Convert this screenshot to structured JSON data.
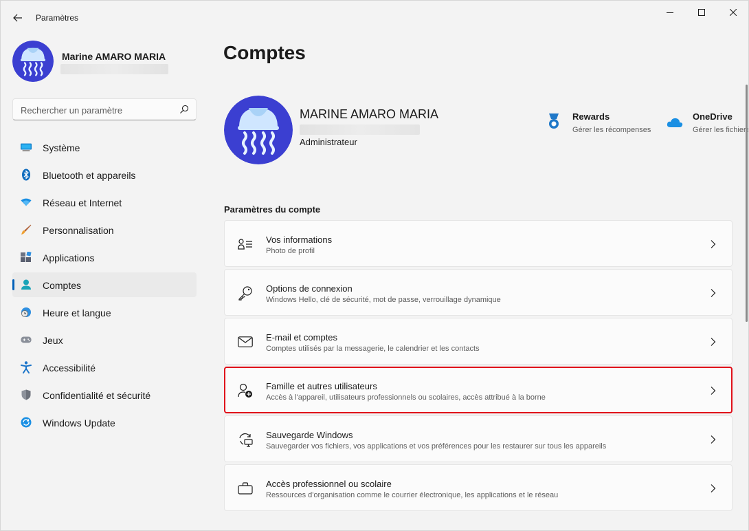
{
  "window": {
    "title": "Paramètres"
  },
  "sidebar": {
    "profile_name": "Marine AMARO MARIA",
    "search_placeholder": "Rechercher un paramètre",
    "items": [
      {
        "label": "Système",
        "icon": "display-icon"
      },
      {
        "label": "Bluetooth et appareils",
        "icon": "bluetooth-icon"
      },
      {
        "label": "Réseau et Internet",
        "icon": "wifi-icon"
      },
      {
        "label": "Personnalisation",
        "icon": "brush-icon"
      },
      {
        "label": "Applications",
        "icon": "apps-icon"
      },
      {
        "label": "Comptes",
        "icon": "person-icon",
        "active": true
      },
      {
        "label": "Heure et langue",
        "icon": "clock-globe-icon"
      },
      {
        "label": "Jeux",
        "icon": "gamepad-icon"
      },
      {
        "label": "Accessibilité",
        "icon": "accessibility-icon"
      },
      {
        "label": "Confidentialité et sécurité",
        "icon": "shield-icon"
      },
      {
        "label": "Windows Update",
        "icon": "update-icon"
      }
    ]
  },
  "main": {
    "title": "Comptes",
    "user": {
      "name": "MARINE AMARO MARIA",
      "role": "Administrateur"
    },
    "rewards": {
      "title": "Rewards",
      "subtitle": "Gérer les récompenses"
    },
    "onedrive": {
      "title": "OneDrive",
      "subtitle": "Gérer les fichiers"
    },
    "section_title": "Paramètres du compte",
    "cards": [
      {
        "title": "Vos informations",
        "subtitle": "Photo de profil",
        "icon": "person-info-icon"
      },
      {
        "title": "Options de connexion",
        "subtitle": "Windows Hello, clé de sécurité, mot de passe, verrouillage dynamique",
        "icon": "key-icon"
      },
      {
        "title": "E-mail et comptes",
        "subtitle": "Comptes utilisés par la messagerie, le calendrier et les contacts",
        "icon": "mail-icon"
      },
      {
        "title": "Famille et autres utilisateurs",
        "subtitle": "Accès à l'appareil, utilisateurs professionnels ou scolaires, accès attribué à la borne",
        "icon": "person-add-icon",
        "highlighted": true
      },
      {
        "title": "Sauvegarde Windows",
        "subtitle": "Sauvegarder vos fichiers, vos applications et vos préférences pour les restaurer sur tous les appareils",
        "icon": "backup-icon"
      },
      {
        "title": "Accès professionnel ou scolaire",
        "subtitle": "Ressources d'organisation comme le courrier électronique, les applications et le réseau",
        "icon": "briefcase-icon"
      }
    ]
  },
  "colors": {
    "accent": "#005fb8",
    "highlight_border": "#e0101a",
    "avatar_bg": "#3b3fd1"
  }
}
